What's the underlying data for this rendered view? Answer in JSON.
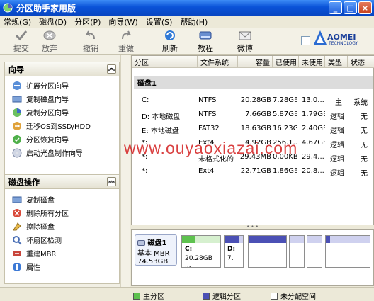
{
  "window": {
    "title": "分区助手家用版",
    "minimize": "_",
    "maximize": "□",
    "close": "×"
  },
  "menu": [
    "常规(G)",
    "磁盘(D)",
    "分区(P)",
    "向导(W)",
    "设置(S)",
    "帮助(H)"
  ],
  "toolbar": {
    "commit": "提交",
    "discard": "放弃",
    "undo": "撤销",
    "redo": "重做",
    "refresh": "刷新",
    "tutorial": "教程",
    "feedback": "微博"
  },
  "logo": {
    "brand": "AOMEI",
    "sub": "TECHNOLOGY"
  },
  "wizard_panel": {
    "title": "向导",
    "items": [
      "扩展分区向导",
      "复制磁盘向导",
      "复制分区向导",
      "迁移OS到SSD/HDD",
      "分区恢复向导",
      "启动光盘制作向导"
    ]
  },
  "disk_panel": {
    "title": "磁盘操作",
    "items": [
      "复制磁盘",
      "删除所有分区",
      "擦除磁盘",
      "坏扇区检测",
      "重建MBR",
      "属性"
    ]
  },
  "table": {
    "headers": [
      "分区",
      "文件系统",
      "容量",
      "已使用",
      "未使用",
      "类型",
      "状态"
    ],
    "disk_label": "磁盘1",
    "rows": [
      [
        "C:",
        "NTFS",
        "20.28GB",
        "7.28GB",
        "13.0...",
        "主",
        "系统"
      ],
      [
        "D: 本地磁盘",
        "NTFS",
        "7.66GB",
        "5.87GB",
        "1.79GB",
        "逻辑",
        "无"
      ],
      [
        "E: 本地磁盘",
        "FAT32",
        "18.63GB",
        "16.23GB",
        "2.40GB",
        "逻辑",
        "无"
      ],
      [
        "*:",
        "Ext4",
        "4.92GB",
        "256.1...",
        "4.67GB",
        "逻辑",
        "无"
      ],
      [
        "*:",
        "未格式化的",
        "29.43MB",
        "0.00KB",
        "29.4...",
        "逻辑",
        "无"
      ],
      [
        "*:",
        "Ext4",
        "22.71GB",
        "1.86GB",
        "20.8...",
        "逻辑",
        "无"
      ]
    ]
  },
  "disk_map": {
    "name": "磁盘1",
    "type": "基本 MBR",
    "size": "74.53GB",
    "c_label": "C:",
    "c_size": "20.28GB ...",
    "d_label": "D:",
    "d_size": "7.",
    "c_used_fraction": 0.36,
    "d_used_fraction": 0.77
  },
  "legend": {
    "primary": "主分区",
    "logical": "逻辑分区",
    "unallocated": "未分配空间"
  },
  "watermark": "www.ouyaoxiazai.com",
  "colors": {
    "titlebar": "#0a53d8",
    "primary": "#7ed36a",
    "logical": "#5a5fc0"
  }
}
